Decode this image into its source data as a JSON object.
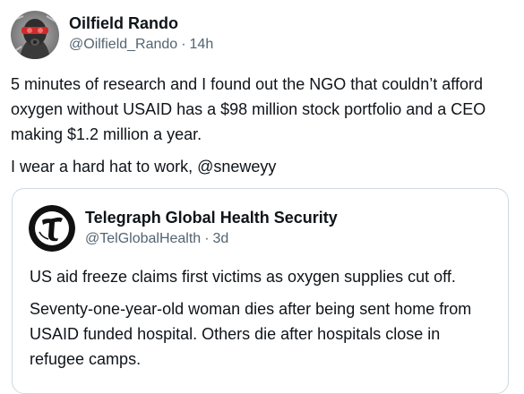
{
  "tweet": {
    "author": {
      "display_name": "Oilfield Rando",
      "handle": "@Oilfield_Rando",
      "separator": "·",
      "time": "14h",
      "avatar_icon": "gas-mask-avatar-icon"
    },
    "paragraphs": [
      "5 minutes of research and I found out the NGO that couldn’t afford oxygen without USAID has a $98 million stock portfolio and a CEO making $1.2 million a year.",
      "I wear a hard hat to work, @sneweyy"
    ]
  },
  "quoted_tweet": {
    "author": {
      "display_name": "Telegraph Global Health Security",
      "handle": "@TelGlobalHealth",
      "separator": "·",
      "time": "3d",
      "avatar_icon": "telegraph-t-logo-icon"
    },
    "paragraphs": [
      "US aid freeze claims first victims as oxygen supplies cut off.",
      "Seventy-one-year-old woman dies after being sent home from USAID funded hospital. Others die after hospitals close in refugee camps."
    ]
  },
  "colors": {
    "text_primary": "#0f1419",
    "text_secondary": "#536471",
    "border": "#cfd9de"
  }
}
